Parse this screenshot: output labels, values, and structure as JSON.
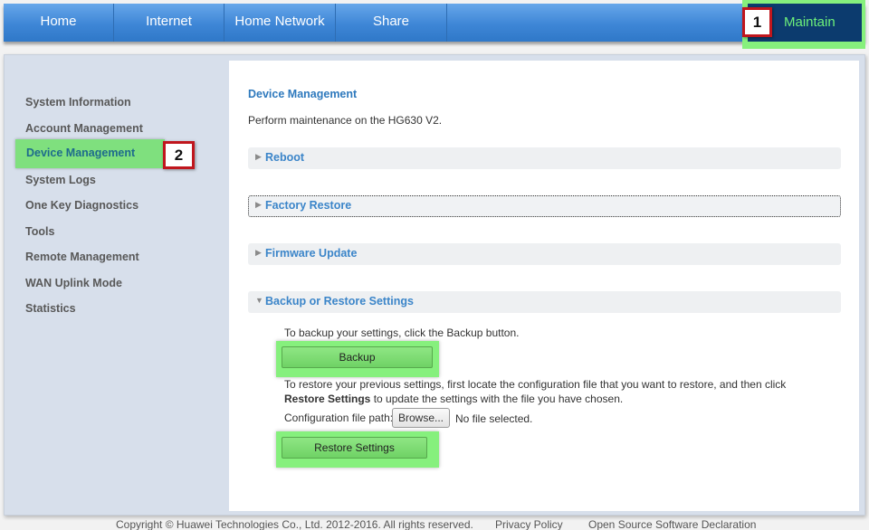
{
  "nav": {
    "items": [
      {
        "label": "Home"
      },
      {
        "label": "Internet"
      },
      {
        "label": "Home Network"
      },
      {
        "label": "Share"
      }
    ],
    "maintain_label": "Maintain",
    "highlight_color": "#86f07d",
    "nav_color": "#3e86d6"
  },
  "annotations": {
    "badge1": "1",
    "badge2": "2",
    "badge_border_color": "#c0161d"
  },
  "sidebar": {
    "items": [
      {
        "label": "System Information"
      },
      {
        "label": "Account Management"
      },
      {
        "label": "Device Management"
      },
      {
        "label": "System Logs"
      },
      {
        "label": "One Key Diagnostics"
      },
      {
        "label": "Tools"
      },
      {
        "label": "Remote Management"
      },
      {
        "label": "WAN Uplink Mode"
      },
      {
        "label": "Statistics"
      }
    ],
    "active_index": 2
  },
  "main": {
    "title": "Device Management",
    "description": "Perform maintenance on the HG630 V2.",
    "sections": [
      {
        "title": "Reboot",
        "expanded": false
      },
      {
        "title": "Factory Restore",
        "expanded": false
      },
      {
        "title": "Firmware Update",
        "expanded": false
      },
      {
        "title": "Backup or Restore Settings",
        "expanded": true
      }
    ],
    "backup": {
      "instruction": "To backup your settings, click the Backup button.",
      "button": "Backup"
    },
    "restore": {
      "instruction_line1": "To restore your previous settings, first locate the configuration file that you want to restore, and then click",
      "instruction_bold": "Restore Settings",
      "instruction_rest": " to update the settings with the file you have chosen.",
      "file_label": "Configuration file path:",
      "browse_button": "Browse...",
      "file_status": "No file selected.",
      "button": "Restore Settings"
    }
  },
  "footer": {
    "copyright": "Copyright © Huawei Technologies Co., Ltd. 2012-2016. All rights reserved.",
    "privacy": "Privacy Policy",
    "open_source": "Open Source Software Declaration"
  }
}
